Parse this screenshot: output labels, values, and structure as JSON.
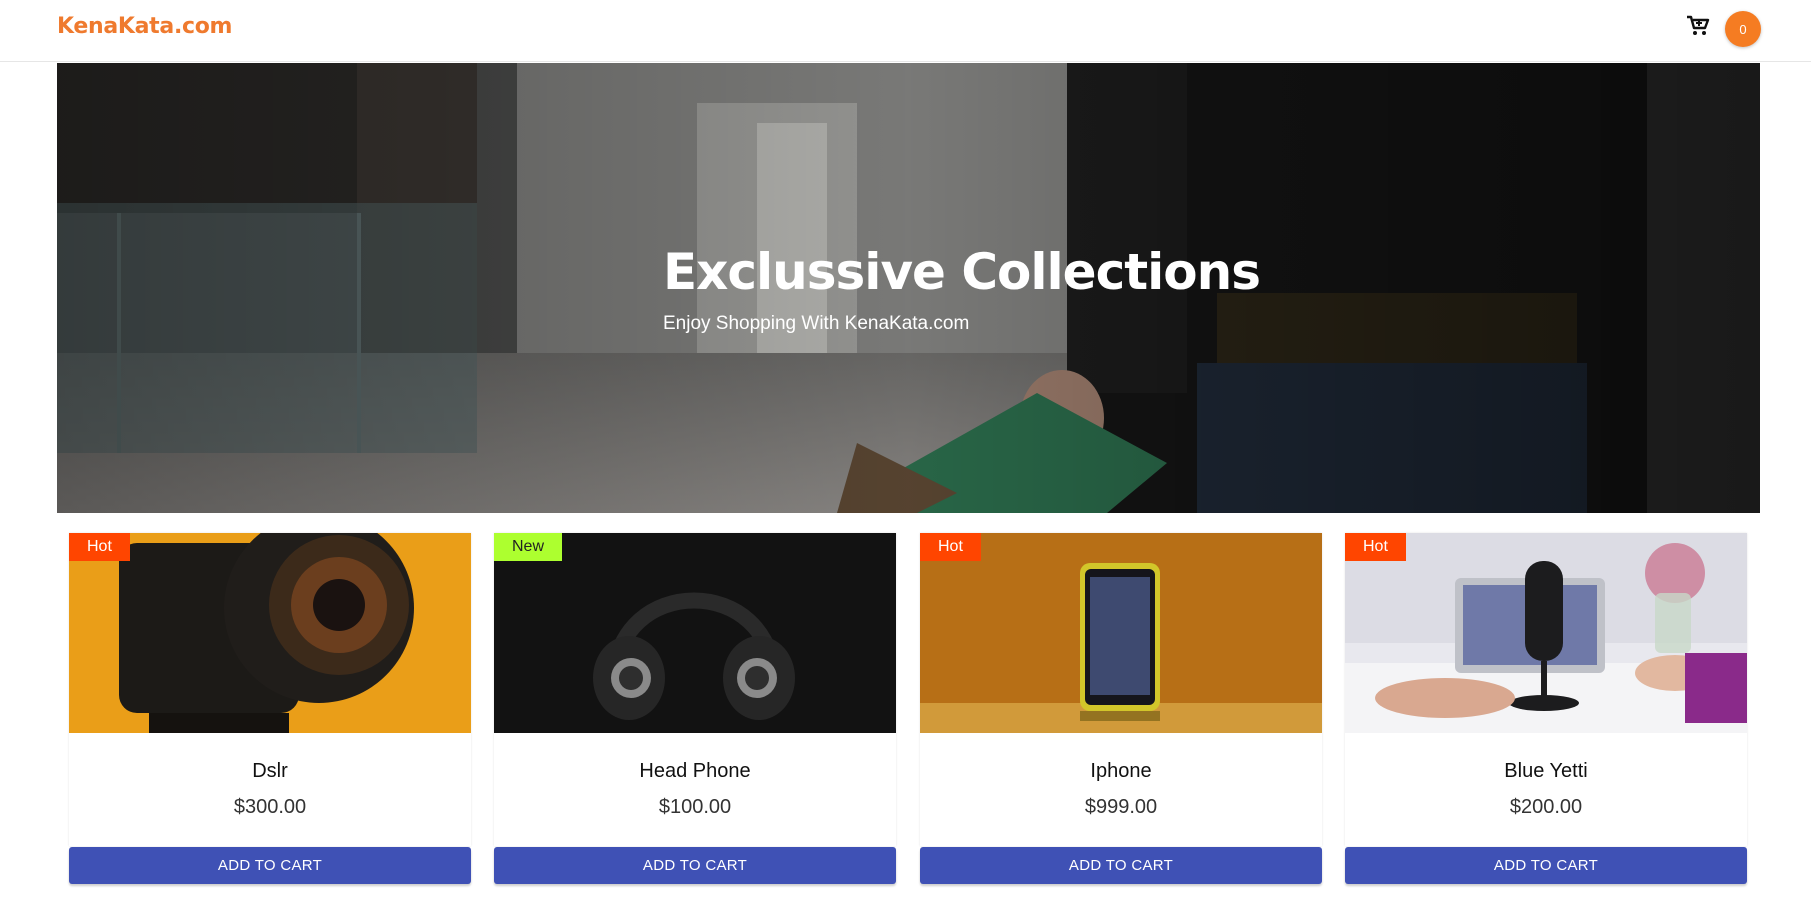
{
  "navbar": {
    "brand": "KenaKata.com",
    "cart_count": "0"
  },
  "hero": {
    "title": "Exclussive Collections",
    "subtitle": "Enjoy Shopping With KenaKata.com"
  },
  "products": [
    {
      "badge": "Hot",
      "name": "Dslr",
      "price": "$300.00",
      "button": "ADD TO CART"
    },
    {
      "badge": "New",
      "name": "Head Phone",
      "price": "$100.00",
      "button": "ADD TO CART"
    },
    {
      "badge": "Hot",
      "name": "Iphone",
      "price": "$999.00",
      "button": "ADD TO CART"
    },
    {
      "badge": "Hot",
      "name": "Blue Yetti",
      "price": "$200.00",
      "button": "ADD TO CART"
    }
  ],
  "colors": {
    "brand": "#ef7a2e",
    "button": "#3f51b5",
    "hot_badge": "#ff4500",
    "new_badge": "#adff2f"
  }
}
